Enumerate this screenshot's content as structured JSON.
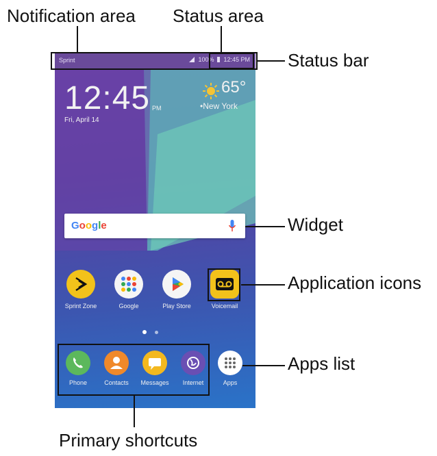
{
  "callouts": {
    "notification_area": "Notification area",
    "status_area": "Status area",
    "status_bar": "Status bar",
    "widget": "Widget",
    "application_icons": "Application icons",
    "apps_list": "Apps list",
    "primary_shortcuts": "Primary shortcuts"
  },
  "status_bar": {
    "carrier": "Sprint",
    "battery": "100%",
    "time": "12:45 PM"
  },
  "clock_widget": {
    "time": "12:45",
    "ampm": "PM",
    "date": "Fri, April 14",
    "temperature": "65°",
    "city": "New York"
  },
  "search_widget": {
    "logo": "Google"
  },
  "apps": [
    {
      "label": "Sprint Zone",
      "icon": "sprint-zone-icon"
    },
    {
      "label": "Google",
      "icon": "google-folder-icon"
    },
    {
      "label": "Play Store",
      "icon": "play-store-icon"
    },
    {
      "label": "Voicemail",
      "icon": "voicemail-icon"
    }
  ],
  "dock": [
    {
      "label": "Phone",
      "icon": "phone-icon"
    },
    {
      "label": "Contacts",
      "icon": "contacts-icon"
    },
    {
      "label": "Messages",
      "icon": "messages-icon"
    },
    {
      "label": "Internet",
      "icon": "internet-icon"
    },
    {
      "label": "Apps",
      "icon": "apps-grid-icon"
    }
  ],
  "colors": {
    "sprint": "#f2c21b",
    "phone": "#5cb85c",
    "contacts": "#f0892a",
    "messages": "#f3b81e",
    "internet": "#6a4fb3",
    "status_bar": "#6a4a9a"
  }
}
